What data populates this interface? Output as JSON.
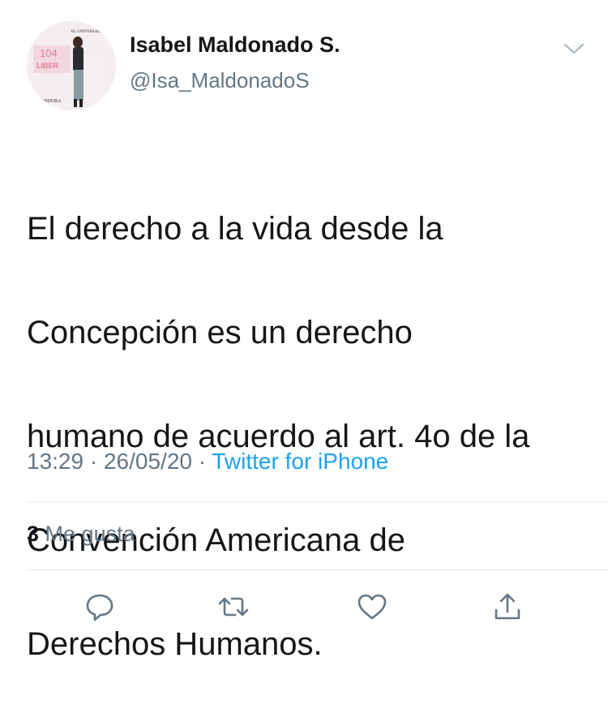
{
  "tweet": {
    "author_name": "Isabel Maldonado S.",
    "author_handle": "@Isa_MaldonadoS",
    "text_lines": [
      "El derecho a la vida desde la",
      "Concepción es un derecho",
      "humano de acuerdo al art. 4o de la",
      "Convención Americana de",
      "Derechos Humanos."
    ],
    "time": "13:29",
    "date": "26/05/20",
    "separator": "·",
    "source": "Twitter for iPhone",
    "likes_count": "3",
    "likes_label": "Me gusta"
  },
  "avatar_text": {
    "number": "104",
    "word": "LIBER",
    "brand": "PANDORA",
    "paper": "EL UNIVERSAL"
  },
  "icons": {
    "menu": "chevron-down-icon",
    "reply": "reply-icon",
    "retweet": "retweet-icon",
    "like": "heart-icon",
    "share": "share-icon"
  },
  "colors": {
    "text": "#14171a",
    "secondary": "#657786",
    "link": "#1da1f2",
    "divider": "#e1e8ed",
    "icon": "#657786"
  }
}
